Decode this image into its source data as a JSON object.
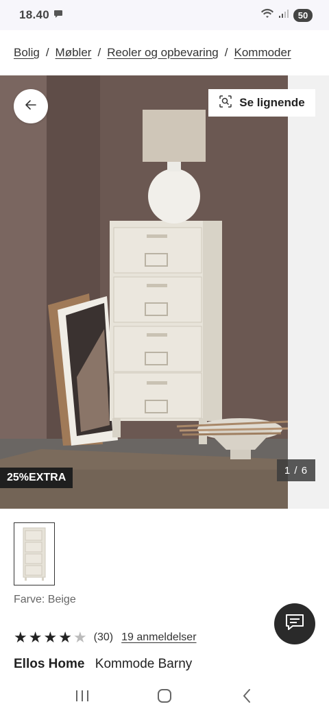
{
  "status_bar": {
    "time": "18.40",
    "battery": "50",
    "icons": [
      "chat-bubble-icon",
      "wifi-icon",
      "signal-icon",
      "battery-icon"
    ]
  },
  "breadcrumb": {
    "items": [
      "Bolig",
      "Møbler",
      "Reoler og opbevaring",
      "Kommoder"
    ],
    "separator": "/"
  },
  "gallery": {
    "similar_label": "Se lignende",
    "promo_badge": "25%EXTRA",
    "counter": "1 / 6"
  },
  "product": {
    "color_label": "Farve: Beige",
    "rating": 4,
    "rating_max": 5,
    "rating_count": "(30)",
    "reviews_link": "19 anmeldelser",
    "brand": "Ellos Home",
    "name": "Kommode Barny"
  },
  "colors": {
    "wall": "#6a5650",
    "dresser": "#e6e2d8",
    "badge_bg": "#1f1f1f",
    "chat_bg": "#2a2a2a"
  }
}
